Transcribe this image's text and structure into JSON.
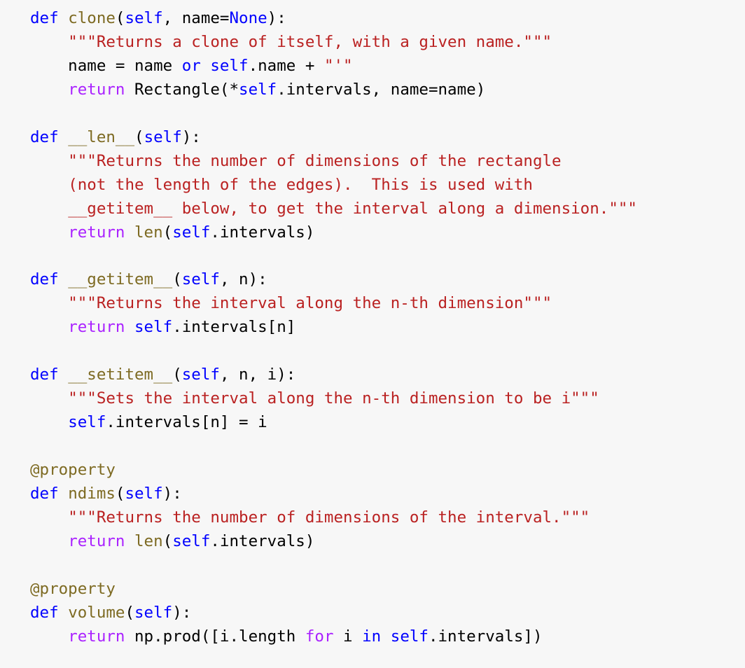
{
  "editor": {
    "background_color": "#f7f7f7",
    "language": "python",
    "font_size_px": 22.5,
    "line_height_px": 34
  },
  "theme": {
    "keyword_color": "#0000ff",
    "control_keyword_color": "#aa22ff",
    "function_name_color": "#7d6a22",
    "builtin_color": "#7d6a22",
    "self_color": "#0000ff",
    "string_color": "#ba2121",
    "decorator_color": "#7d6a22",
    "text_color": "#000000"
  },
  "code": {
    "lines": [
      {
        "index": 1,
        "text": "def clone(self, name=None):",
        "tokens": [
          {
            "t": "def",
            "c": "k"
          },
          {
            "t": " ",
            "c": "n"
          },
          {
            "t": "clone",
            "c": "nf"
          },
          {
            "t": "(",
            "c": "p"
          },
          {
            "t": "self",
            "c": "bp"
          },
          {
            "t": ", name=",
            "c": "n"
          },
          {
            "t": "None",
            "c": "bp"
          },
          {
            "t": "):",
            "c": "p"
          }
        ]
      },
      {
        "index": 2,
        "text": "    \"\"\"Returns a clone of itself, with a given name.\"\"\"",
        "tokens": [
          {
            "t": "    ",
            "c": "n"
          },
          {
            "t": "\"\"\"Returns a clone of itself, with a given name.\"\"\"",
            "c": "s"
          }
        ]
      },
      {
        "index": 3,
        "text": "    name = name or self.name + \"'\"",
        "tokens": [
          {
            "t": "    name = name ",
            "c": "n"
          },
          {
            "t": "or",
            "c": "kb"
          },
          {
            "t": " ",
            "c": "n"
          },
          {
            "t": "self",
            "c": "bp"
          },
          {
            "t": ".name + ",
            "c": "n"
          },
          {
            "t": "\"'\"",
            "c": "s"
          }
        ]
      },
      {
        "index": 4,
        "text": "    return Rectangle(*self.intervals, name=name)",
        "tokens": [
          {
            "t": "    ",
            "c": "n"
          },
          {
            "t": "return",
            "c": "kw"
          },
          {
            "t": " Rectangle(*",
            "c": "n"
          },
          {
            "t": "self",
            "c": "bp"
          },
          {
            "t": ".intervals, name=name)",
            "c": "n"
          }
        ]
      },
      {
        "index": 5,
        "text": "",
        "tokens": []
      },
      {
        "index": 6,
        "text": "def __len__(self):",
        "tokens": [
          {
            "t": "def",
            "c": "k"
          },
          {
            "t": " ",
            "c": "n"
          },
          {
            "t": "__len__",
            "c": "nf"
          },
          {
            "t": "(",
            "c": "p"
          },
          {
            "t": "self",
            "c": "bp"
          },
          {
            "t": "):",
            "c": "p"
          }
        ]
      },
      {
        "index": 7,
        "text": "    \"\"\"Returns the number of dimensions of the rectangle",
        "tokens": [
          {
            "t": "    ",
            "c": "n"
          },
          {
            "t": "\"\"\"Returns the number of dimensions of the rectangle",
            "c": "s"
          }
        ]
      },
      {
        "index": 8,
        "text": "    (not the length of the edges).  This is used with",
        "tokens": [
          {
            "t": "    ",
            "c": "n"
          },
          {
            "t": "(not the length of the edges).  This is used with",
            "c": "s"
          }
        ]
      },
      {
        "index": 9,
        "text": "    __getitem__ below, to get the interval along a dimension.\"\"\"",
        "tokens": [
          {
            "t": "    ",
            "c": "n"
          },
          {
            "t": "__getitem__ below, to get the interval along a dimension.\"\"\"",
            "c": "s"
          }
        ]
      },
      {
        "index": 10,
        "text": "    return len(self.intervals)",
        "tokens": [
          {
            "t": "    ",
            "c": "n"
          },
          {
            "t": "return",
            "c": "kw"
          },
          {
            "t": " ",
            "c": "n"
          },
          {
            "t": "len",
            "c": "nb"
          },
          {
            "t": "(",
            "c": "p"
          },
          {
            "t": "self",
            "c": "bp"
          },
          {
            "t": ".intervals)",
            "c": "n"
          }
        ]
      },
      {
        "index": 11,
        "text": "",
        "tokens": []
      },
      {
        "index": 12,
        "text": "def __getitem__(self, n):",
        "tokens": [
          {
            "t": "def",
            "c": "k"
          },
          {
            "t": " ",
            "c": "n"
          },
          {
            "t": "__getitem__",
            "c": "nf"
          },
          {
            "t": "(",
            "c": "p"
          },
          {
            "t": "self",
            "c": "bp"
          },
          {
            "t": ", n):",
            "c": "n"
          }
        ]
      },
      {
        "index": 13,
        "text": "    \"\"\"Returns the interval along the n-th dimension\"\"\"",
        "tokens": [
          {
            "t": "    ",
            "c": "n"
          },
          {
            "t": "\"\"\"Returns the interval along the n-th dimension\"\"\"",
            "c": "s"
          }
        ]
      },
      {
        "index": 14,
        "text": "    return self.intervals[n]",
        "tokens": [
          {
            "t": "    ",
            "c": "n"
          },
          {
            "t": "return",
            "c": "kw"
          },
          {
            "t": " ",
            "c": "n"
          },
          {
            "t": "self",
            "c": "bp"
          },
          {
            "t": ".intervals[n]",
            "c": "n"
          }
        ]
      },
      {
        "index": 15,
        "text": "",
        "tokens": []
      },
      {
        "index": 16,
        "text": "def __setitem__(self, n, i):",
        "tokens": [
          {
            "t": "def",
            "c": "k"
          },
          {
            "t": " ",
            "c": "n"
          },
          {
            "t": "__setitem__",
            "c": "nf"
          },
          {
            "t": "(",
            "c": "p"
          },
          {
            "t": "self",
            "c": "bp"
          },
          {
            "t": ", n, i):",
            "c": "n"
          }
        ]
      },
      {
        "index": 17,
        "text": "    \"\"\"Sets the interval along the n-th dimension to be i\"\"\"",
        "tokens": [
          {
            "t": "    ",
            "c": "n"
          },
          {
            "t": "\"\"\"Sets the interval along the n-th dimension to be i\"\"\"",
            "c": "s"
          }
        ]
      },
      {
        "index": 18,
        "text": "    self.intervals[n] = i",
        "tokens": [
          {
            "t": "    ",
            "c": "n"
          },
          {
            "t": "self",
            "c": "bp"
          },
          {
            "t": ".intervals[n] = i",
            "c": "n"
          }
        ]
      },
      {
        "index": 19,
        "text": "",
        "tokens": []
      },
      {
        "index": 20,
        "text": "@property",
        "tokens": [
          {
            "t": "@property",
            "c": "nd"
          }
        ]
      },
      {
        "index": 21,
        "text": "def ndims(self):",
        "tokens": [
          {
            "t": "def",
            "c": "k"
          },
          {
            "t": " ",
            "c": "n"
          },
          {
            "t": "ndims",
            "c": "nf"
          },
          {
            "t": "(",
            "c": "p"
          },
          {
            "t": "self",
            "c": "bp"
          },
          {
            "t": "):",
            "c": "p"
          }
        ]
      },
      {
        "index": 22,
        "text": "    \"\"\"Returns the number of dimensions of the interval.\"\"\"",
        "tokens": [
          {
            "t": "    ",
            "c": "n"
          },
          {
            "t": "\"\"\"Returns the number of dimensions of the interval.\"\"\"",
            "c": "s"
          }
        ]
      },
      {
        "index": 23,
        "text": "    return len(self.intervals)",
        "tokens": [
          {
            "t": "    ",
            "c": "n"
          },
          {
            "t": "return",
            "c": "kw"
          },
          {
            "t": " ",
            "c": "n"
          },
          {
            "t": "len",
            "c": "nb"
          },
          {
            "t": "(",
            "c": "p"
          },
          {
            "t": "self",
            "c": "bp"
          },
          {
            "t": ".intervals)",
            "c": "n"
          }
        ]
      },
      {
        "index": 24,
        "text": "",
        "tokens": []
      },
      {
        "index": 25,
        "text": "@property",
        "tokens": [
          {
            "t": "@property",
            "c": "nd"
          }
        ]
      },
      {
        "index": 26,
        "text": "def volume(self):",
        "tokens": [
          {
            "t": "def",
            "c": "k"
          },
          {
            "t": " ",
            "c": "n"
          },
          {
            "t": "volume",
            "c": "nf"
          },
          {
            "t": "(",
            "c": "p"
          },
          {
            "t": "self",
            "c": "bp"
          },
          {
            "t": "):",
            "c": "p"
          }
        ]
      },
      {
        "index": 27,
        "text": "    return np.prod([i.length for i in self.intervals])",
        "tokens": [
          {
            "t": "    ",
            "c": "n"
          },
          {
            "t": "return",
            "c": "kw"
          },
          {
            "t": " np.prod([i.length ",
            "c": "n"
          },
          {
            "t": "for",
            "c": "kw"
          },
          {
            "t": " i ",
            "c": "n"
          },
          {
            "t": "in",
            "c": "kb"
          },
          {
            "t": " ",
            "c": "n"
          },
          {
            "t": "self",
            "c": "bp"
          },
          {
            "t": ".intervals])",
            "c": "n"
          }
        ]
      }
    ]
  }
}
